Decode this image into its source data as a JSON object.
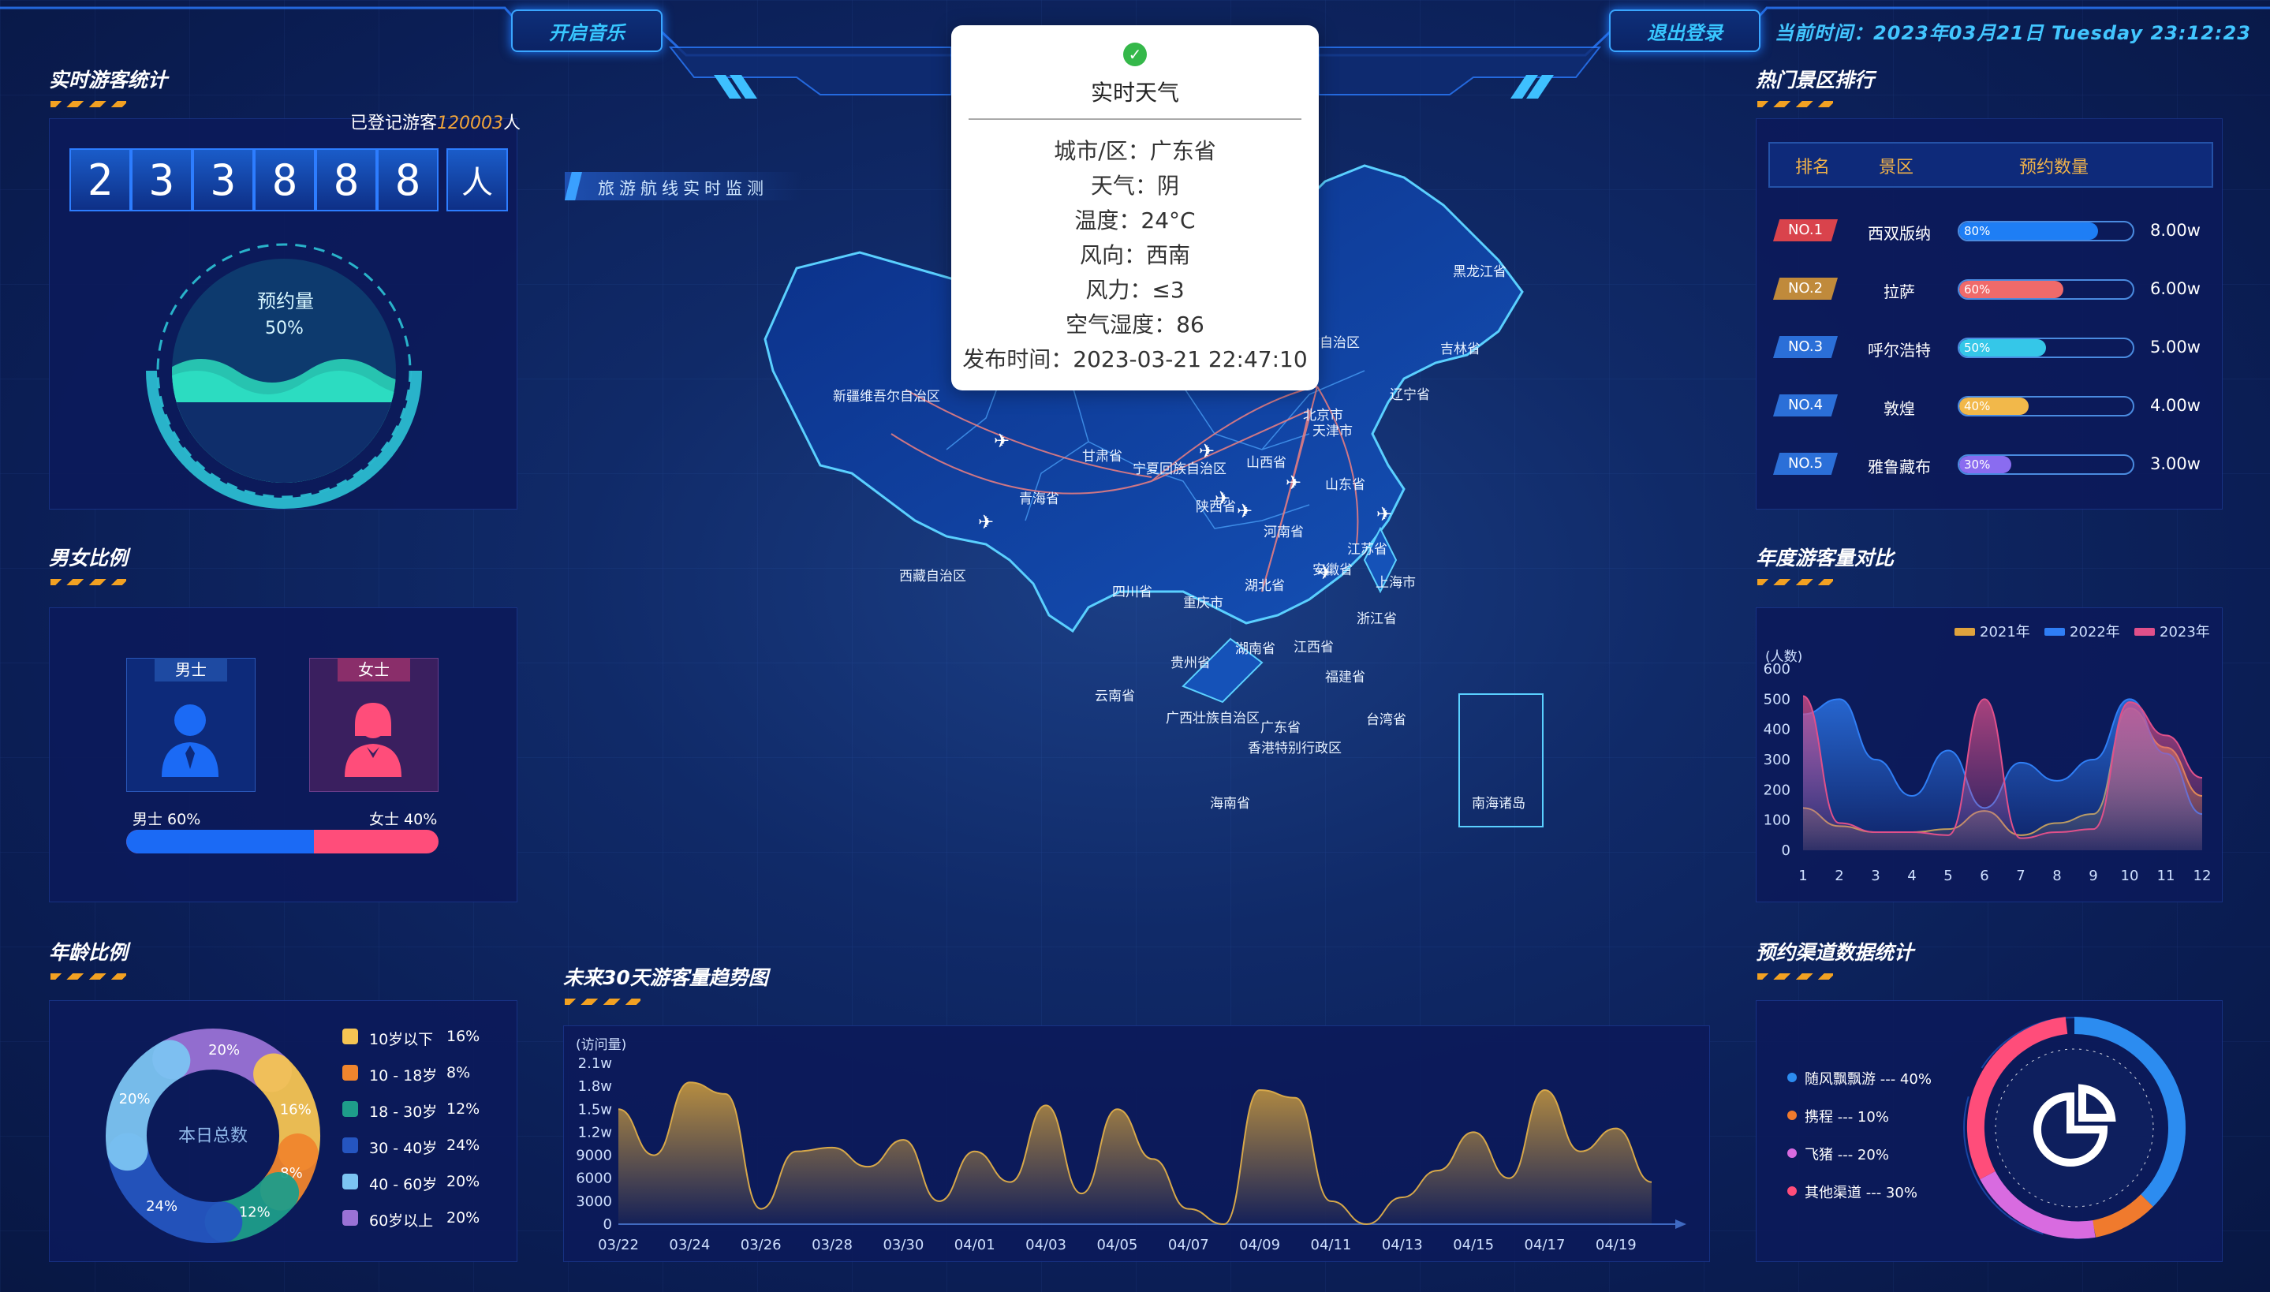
{
  "topbar": {
    "music_label": "开启音乐",
    "logout_label": "退出登录",
    "time_label": "当前时间：2023年03月21日 Tuesday 23:12:23"
  },
  "visitors": {
    "title": "实时游客统计",
    "registered_prefix": "已登记游客",
    "registered_count": "120003",
    "registered_suffix": "人",
    "digits": [
      "2",
      "3",
      "3",
      "8",
      "8",
      "8"
    ],
    "unit": "人",
    "gauge_label": "预约量",
    "gauge_value": "50%"
  },
  "gender": {
    "title": "男女比例",
    "male_label": "男士",
    "female_label": "女士",
    "male_pct_label": "男士 60%",
    "female_pct_label": "女士 40%",
    "male_share": 0.6
  },
  "age": {
    "title": "年龄比例",
    "center_label": "本日总数",
    "legend": [
      {
        "label": "10岁以下",
        "pct": "16%",
        "color": "#f5c453"
      },
      {
        "label": "10 - 18岁",
        "pct": "8%",
        "color": "#f0852d"
      },
      {
        "label": "18 - 30岁",
        "pct": "12%",
        "color": "#1e9d8a"
      },
      {
        "label": "30 - 40岁",
        "pct": "24%",
        "color": "#2555c0"
      },
      {
        "label": "40 - 60岁",
        "pct": "20%",
        "color": "#7cc4f2"
      },
      {
        "label": "60岁以上",
        "pct": "20%",
        "color": "#9a72d6"
      }
    ],
    "ring_labels": [
      "20%",
      "16%",
      "8%",
      "12%",
      "24%",
      "20%"
    ]
  },
  "map": {
    "banner": "旅游航线实时监测",
    "provinces": [
      "新疆维吾尔自治区",
      "西藏自治区",
      "青海省",
      "甘肃省",
      "宁夏回族自治区",
      "陕西省",
      "四川省",
      "重庆市",
      "云南省",
      "贵州省",
      "广西壮族自治区",
      "广东省",
      "海南省",
      "湖南省",
      "湖北省",
      "河南省",
      "山西省",
      "内蒙古自治区",
      "黑龙江省",
      "吉林省",
      "辽宁省",
      "北京市",
      "天津市",
      "山东省",
      "江苏省",
      "安徽省",
      "上海市",
      "浙江省",
      "江西省",
      "福建省",
      "台湾省",
      "香港特别行政区",
      "南海诸岛"
    ]
  },
  "weather": {
    "title": "实时天气",
    "rows": [
      "城市/区：广东省",
      "天气：阴",
      "温度：24°C",
      "风向：西南",
      "风力：≤3",
      "空气湿度：86",
      "发布时间：2023-03-21 22:47:10"
    ]
  },
  "ranking": {
    "title": "热门景区排行",
    "headers": [
      "排名",
      "景区",
      "预约数量"
    ],
    "rows": [
      {
        "rank": "NO.1",
        "name": "西双版纳",
        "pct": "80%",
        "value": "8.00w",
        "fill": 0.8,
        "color": "#d9434c"
      },
      {
        "rank": "NO.2",
        "name": "拉萨",
        "pct": "60%",
        "value": "6.00w",
        "fill": 0.6,
        "color": "#c08a3b"
      },
      {
        "rank": "NO.3",
        "name": "呼尔浩特",
        "pct": "50%",
        "value": "5.00w",
        "fill": 0.5,
        "color": "#2b6fd8"
      },
      {
        "rank": "NO.4",
        "name": "敦煌",
        "pct": "40%",
        "value": "4.00w",
        "fill": 0.4,
        "color": "#2b6fd8"
      },
      {
        "rank": "NO.5",
        "name": "雅鲁藏布",
        "pct": "30%",
        "value": "3.00w",
        "fill": 0.3,
        "color": "#2b6fd8"
      }
    ]
  },
  "yearly": {
    "title": "年度游客量对比"
  },
  "trend": {
    "title": "未来30天游客量趋势图"
  },
  "channels": {
    "title": "预约渠道数据统计",
    "items": [
      {
        "label": "随风飘飘游 --- 40%",
        "color": "#2c8cf0"
      },
      {
        "label": "携程 --- 10%",
        "color": "#f07a2d"
      },
      {
        "label": "飞猪 --- 20%",
        "color": "#d86be0"
      },
      {
        "label": "其他渠道 --- 30%",
        "color": "#ff4d7a"
      }
    ]
  },
  "chart_data": [
    {
      "type": "area",
      "title": "年度游客量对比",
      "ylabel": "(人数)",
      "ylim": [
        0,
        600
      ],
      "categories": [
        "1",
        "2",
        "3",
        "4",
        "5",
        "6",
        "7",
        "8",
        "9",
        "10",
        "11",
        "12"
      ],
      "series": [
        {
          "name": "2021年",
          "color": "#e0a33d",
          "values": [
            140,
            80,
            60,
            60,
            70,
            130,
            50,
            90,
            120,
            470,
            340,
            180
          ]
        },
        {
          "name": "2022年",
          "color": "#2f7ef5",
          "values": [
            450,
            500,
            300,
            180,
            330,
            140,
            290,
            230,
            300,
            500,
            320,
            120
          ]
        },
        {
          "name": "2023年",
          "color": "#e0508a",
          "values": [
            510,
            90,
            60,
            60,
            50,
            500,
            40,
            60,
            70,
            490,
            380,
            240
          ]
        }
      ],
      "grid": false,
      "legend": "top-right"
    },
    {
      "type": "area",
      "title": "未来30天游客量趋势图",
      "ylabel": "(访问量)",
      "ylim": [
        0,
        21000
      ],
      "ytick_labels": [
        "0",
        "3000",
        "6000",
        "9000",
        "1.2w",
        "1.5w",
        "1.8w",
        "2.1w"
      ],
      "categories": [
        "03/22",
        "03/23",
        "03/24",
        "03/25",
        "03/26",
        "03/27",
        "03/28",
        "03/29",
        "03/30",
        "03/31",
        "04/01",
        "04/02",
        "04/03",
        "04/04",
        "04/05",
        "04/06",
        "04/07",
        "04/08",
        "04/09",
        "04/10",
        "04/11",
        "04/12",
        "04/13",
        "04/14",
        "04/15",
        "04/16",
        "04/17",
        "04/18",
        "04/19",
        "04/20"
      ],
      "xtick_labels": [
        "03/22",
        "03/24",
        "03/26",
        "03/28",
        "03/30",
        "04/01",
        "04/03",
        "04/05",
        "04/07",
        "04/09",
        "04/11",
        "04/13",
        "04/15",
        "04/17",
        "04/19"
      ],
      "values": [
        15000,
        9000,
        18500,
        17000,
        2000,
        9500,
        10000,
        7500,
        11000,
        3000,
        9500,
        5500,
        15500,
        4000,
        15000,
        8500,
        2000,
        0,
        17500,
        16500,
        3000,
        0,
        3500,
        7000,
        12000,
        6000,
        17500,
        9500,
        12500,
        5500
      ],
      "color": "#c99a3e",
      "grid": false
    }
  ]
}
